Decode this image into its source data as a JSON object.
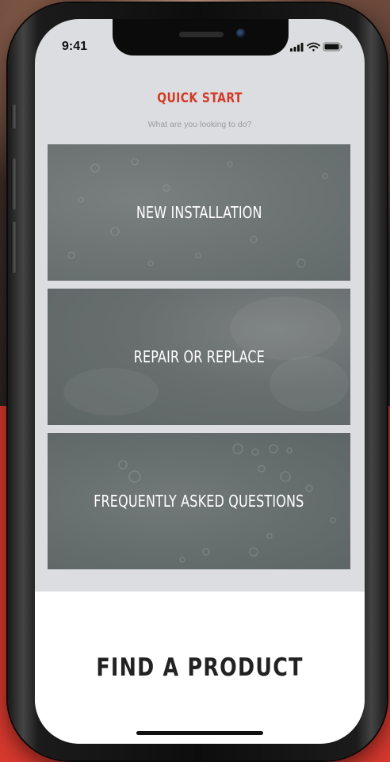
{
  "status_bar": {
    "time": "9:41",
    "icons": [
      "signal-icon",
      "wifi-icon",
      "battery-icon"
    ]
  },
  "header": {
    "title": "QUICK START",
    "subtitle": "What are you looking to do?"
  },
  "options": [
    {
      "label": "NEW INSTALLATION"
    },
    {
      "label": "REPAIR OR REPLACE"
    },
    {
      "label": "FREQUENTLY ASKED QUESTIONS"
    }
  ],
  "find_product": {
    "label": "FIND A PRODUCT"
  },
  "colors": {
    "accent": "#d23a26",
    "background_red": "#d9392e",
    "tile_gray": "#6d7473",
    "screen_bg": "#dcdde0"
  }
}
